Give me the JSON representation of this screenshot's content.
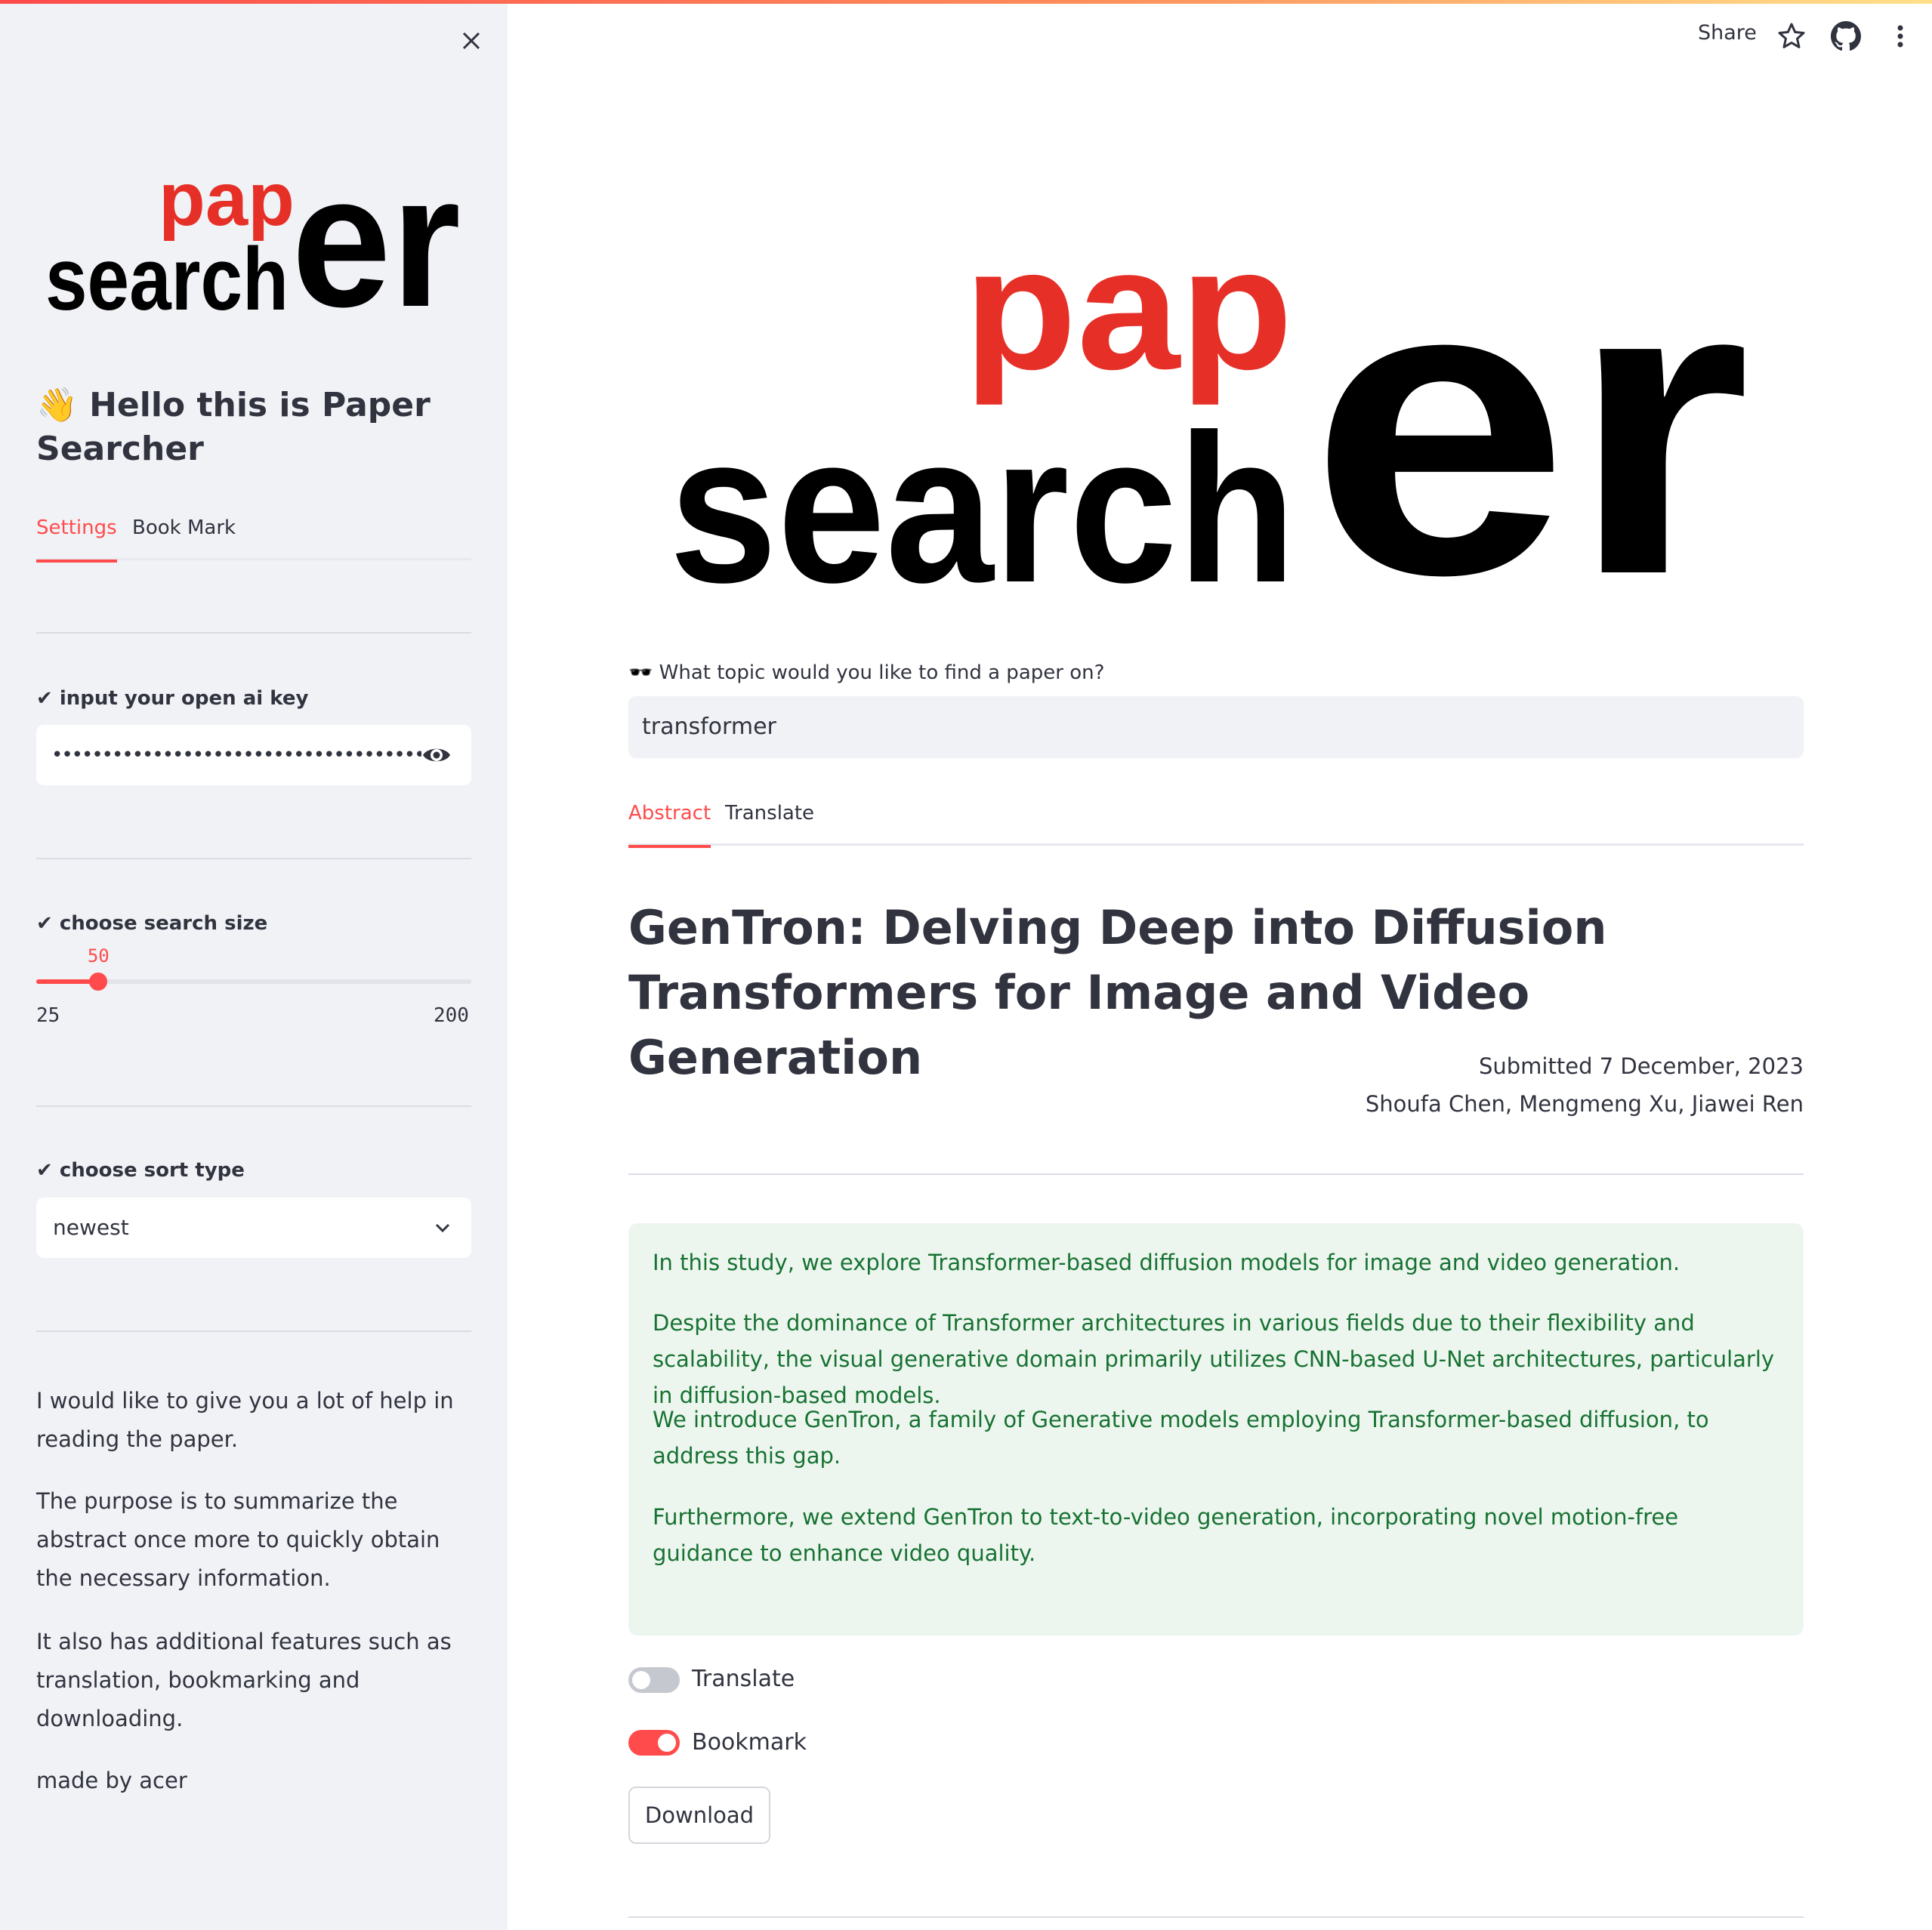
{
  "colors": {
    "accent": "#ff4b4b",
    "logo_red": "#e63027",
    "logo_black": "#000000",
    "sidebar_bg": "#f0f2f6",
    "abstract_bg": "#edf6ee",
    "abstract_text": "#177233",
    "toggle_off": "#c6c8cf"
  },
  "header": {
    "share_label": "Share",
    "icons": [
      "star-icon",
      "github-icon",
      "more-vertical-icon"
    ]
  },
  "logo": {
    "top": "pap",
    "bottom": "search",
    "big": "er"
  },
  "sidebar": {
    "close_icon": "close-icon",
    "title": "👋 Hello this is Paper Searcher",
    "tabs": [
      {
        "label": "Settings",
        "active": true
      },
      {
        "label": "Book Mark",
        "active": false
      }
    ],
    "api_key": {
      "label": "✔ input your open ai key",
      "value": "••••••••••••••••••••••••••••••••••••••••••••••••••",
      "icon": "eye-icon"
    },
    "search_size": {
      "label": "✔ choose search size",
      "value": 50,
      "value_text": "50",
      "min": 25,
      "min_text": "25",
      "max": 200,
      "max_text": "200"
    },
    "sort_type": {
      "label": "✔ choose sort type",
      "selected": "newest",
      "icon": "chevron-down-icon"
    },
    "paragraphs": [
      "I would like to give you a lot of help in reading the paper.",
      "The purpose is to summarize the abstract once more to quickly obtain the necessary information.",
      "It also has additional features such as translation, bookmarking and downloading.",
      "made by acer"
    ]
  },
  "main": {
    "topic_label": "🕶️ What topic would you like to find a paper on?",
    "topic_value": "transformer",
    "tabs": [
      {
        "label": "Abstract",
        "active": true
      },
      {
        "label": "Translate",
        "active": false
      }
    ],
    "paper": {
      "title": "GenTron: Delving Deep into Diffusion Transformers for Image and Video Generation",
      "submitted": "Submitted 7 December, 2023",
      "authors": "Shoufa Chen, Mengmeng Xu, Jiawei Ren",
      "abstract": [
        "In this study, we explore Transformer-based diffusion models for image and video generation.",
        "Despite the dominance of Transformer architectures in various fields due to their flexibility and scalability, the visual generative domain primarily utilizes CNN-based U-Net architectures, particularly in diffusion-based models.",
        "We introduce GenTron, a family of Generative models employing Transformer-based diffusion, to address this gap.",
        "Furthermore, we extend GenTron to text-to-video generation, incorporating novel motion-free guidance to enhance video quality."
      ]
    },
    "toggles": [
      {
        "label": "Translate",
        "on": false
      },
      {
        "label": "Bookmark",
        "on": true
      }
    ],
    "download_label": "Download"
  }
}
